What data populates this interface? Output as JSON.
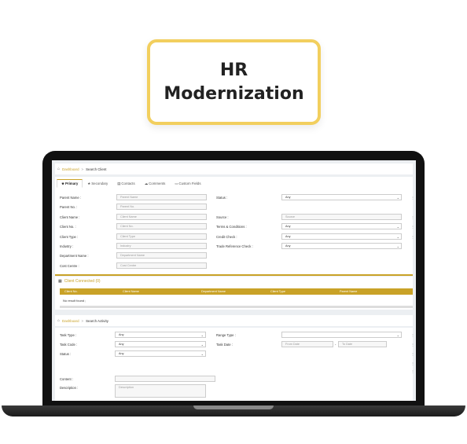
{
  "title_card": {
    "line1": "HR",
    "line2": "Modernization"
  },
  "breadcrumb1": {
    "link": "Dashboard",
    "sep": ">",
    "current": "Search Client"
  },
  "tabs": [
    {
      "icon": "★",
      "label": "Primary"
    },
    {
      "icon": "★",
      "label": "Secondary"
    },
    {
      "icon": "▤",
      "label": "Contacts"
    },
    {
      "icon": "☁",
      "label": "Comments"
    },
    {
      "icon": "▭",
      "label": "Custom Fields"
    }
  ],
  "client_form": {
    "parent_name": {
      "label": "Parent Name :",
      "placeholder": "Parent Name"
    },
    "parent_no": {
      "label": "Parent No. :",
      "placeholder": "Parent No."
    },
    "client_name": {
      "label": "Client Name :",
      "placeholder": "Client Name"
    },
    "client_no": {
      "label": "Client No. :",
      "placeholder": "Client No."
    },
    "client_type": {
      "label": "Client Type :",
      "placeholder": "Client Type"
    },
    "industry": {
      "label": "Industry :",
      "placeholder": "Industry"
    },
    "department_name": {
      "label": "Department Name :",
      "placeholder": "Department Name"
    },
    "cost_centre": {
      "label": "Cost Centre :",
      "placeholder": "Cost Centre"
    },
    "status": {
      "label": "Status :",
      "value": "Any"
    },
    "source": {
      "label": "Source :",
      "placeholder": "Source"
    },
    "terms": {
      "label": "Terms & Conditions :",
      "value": "Any"
    },
    "credit_check": {
      "label": "Credit Check :",
      "value": "Any"
    },
    "trade_ref": {
      "label": "Trade Reference Check :",
      "value": "Any"
    }
  },
  "client_connected": {
    "title": "Client Connected (0)",
    "columns": [
      "Client No.",
      "Client Name",
      "Department Name",
      "Client Type",
      "Parent Name"
    ],
    "empty_text": "No result found ;"
  },
  "breadcrumb2": {
    "link": "Dashboard",
    "sep": ">",
    "current": "Search Activity"
  },
  "activity_form": {
    "task_type": {
      "label": "Task Type :",
      "value": "Any"
    },
    "task_code": {
      "label": "Task Code :",
      "value": "Any"
    },
    "status": {
      "label": "Status :",
      "value": "Any"
    },
    "range_type": {
      "label": "Range Type :",
      "value": ""
    },
    "task_date": {
      "label": "Task Date :",
      "from": "From Date",
      "to": "To Date"
    },
    "content": {
      "label": "Content :",
      "placeholder": ""
    },
    "description": {
      "label": "Description :",
      "placeholder": "Description"
    }
  }
}
